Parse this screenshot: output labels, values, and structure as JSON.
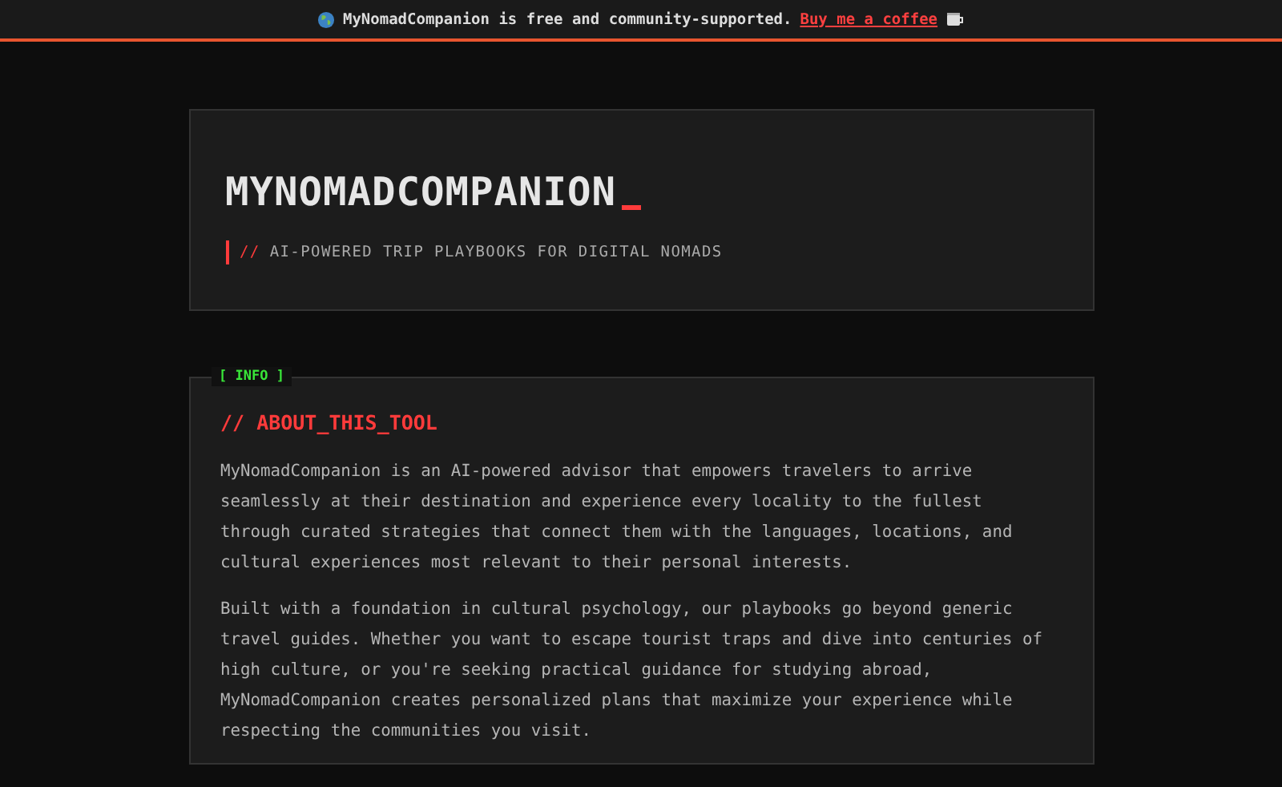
{
  "banner": {
    "text": "MyNomadCompanion is free and community-supported.",
    "link": "Buy me a coffee"
  },
  "header": {
    "title": "MYNOMADCOMPANION",
    "subtitle_prefix": "//",
    "subtitle": "AI-POWERED TRIP PLAYBOOKS FOR DIGITAL NOMADS"
  },
  "info_card": {
    "tag": "[ INFO ]",
    "heading": "// ABOUT_THIS_TOOL",
    "paragraphs": [
      "MyNomadCompanion is an AI-powered advisor that empowers travelers to arrive seamlessly at their destination and experience every locality to the fullest through curated strategies that connect them with the languages, locations, and cultural experiences most relevant to their personal interests.",
      "Built with a foundation in cultural psychology, our playbooks go beyond generic travel guides. Whether you want to escape tourist traps and dive into centuries of high culture, or you're seeking practical guidance for studying abroad, MyNomadCompanion creates personalized plans that maximize your experience while respecting the communities you visit."
    ]
  }
}
